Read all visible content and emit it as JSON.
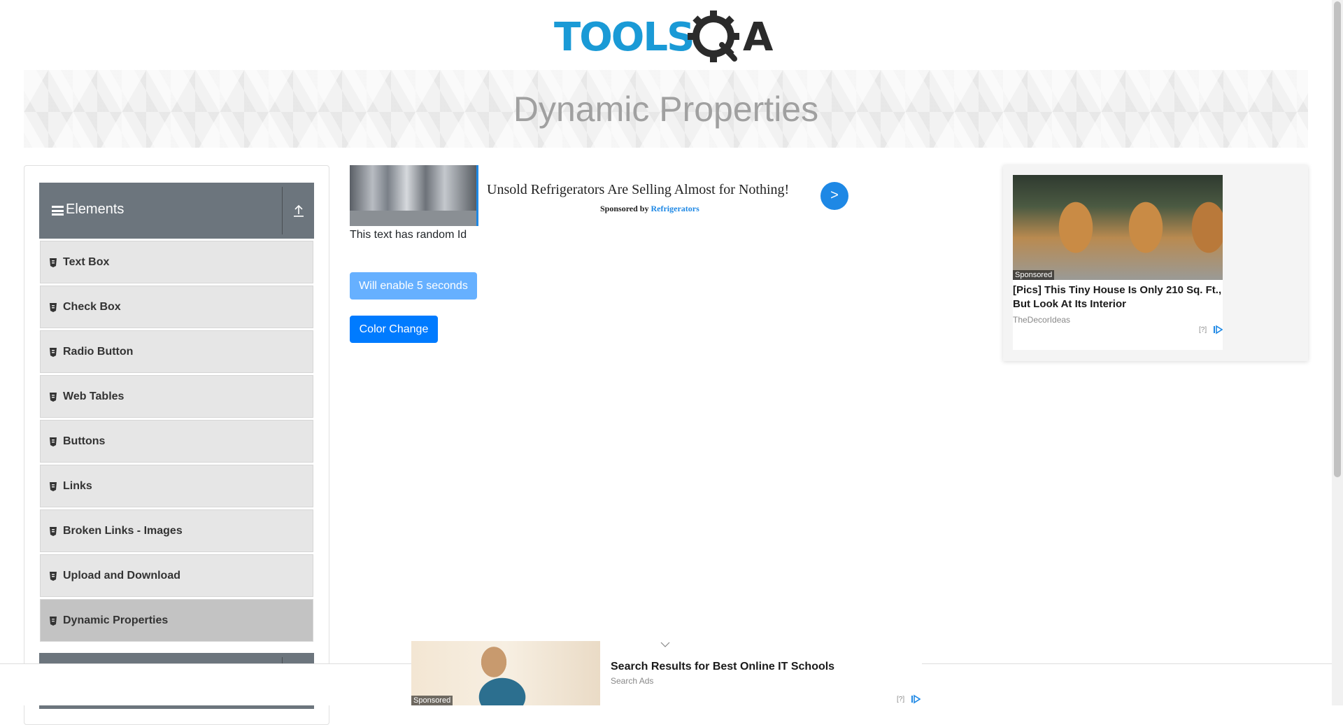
{
  "logo": {
    "text_left": "TOOLS",
    "text_right": "A",
    "colors": {
      "tools": "#1a9ad6",
      "gear": "#2b2b2b"
    }
  },
  "banner": {
    "title": "Dynamic Properties"
  },
  "sidebar": {
    "group": {
      "title": "Elements"
    },
    "items": [
      {
        "label": "Text Box"
      },
      {
        "label": "Check Box"
      },
      {
        "label": "Radio Button"
      },
      {
        "label": "Web Tables"
      },
      {
        "label": "Buttons"
      },
      {
        "label": "Links"
      },
      {
        "label": "Broken Links - Images"
      },
      {
        "label": "Upload and Download"
      },
      {
        "label": "Dynamic Properties"
      }
    ],
    "active_index": 8
  },
  "ad_top": {
    "headline": "Unsold Refrigerators Are Selling Almost for Nothing!",
    "sponsored_prefix": "Sponsored by",
    "sponsor_name": "Refrigerators",
    "go_label": ">"
  },
  "main": {
    "random_id_text": "This text has random Id",
    "enable_button_label": "Will enable 5 seconds",
    "color_change_label": "Color Change"
  },
  "ad_right": {
    "sponsored_label": "Sponsored",
    "title": "[Pics] This Tiny House Is Only 210 Sq. Ft., But Look At Its Interior",
    "source": "TheDecorIdeas",
    "info": "[?]"
  },
  "ad_bottom": {
    "sponsored_label": "Sponsored",
    "title": "Search Results for Best Online IT Schools",
    "source": "Search Ads",
    "info": "[?]"
  },
  "colors": {
    "primary": "#007bff",
    "primary_disabled": "#66b0ff",
    "sidebar_header": "#6c757d",
    "menu_item": "#e6e6e6",
    "menu_item_active": "#c3c3c3"
  }
}
